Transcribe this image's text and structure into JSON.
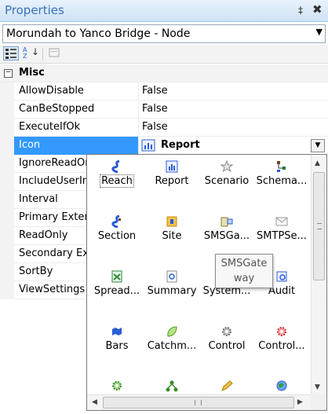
{
  "window": {
    "title": "Properties",
    "pin_glyph": "‡",
    "close_glyph": "✖"
  },
  "object_selector": {
    "value": "Morundah to Yanco Bridge - Node"
  },
  "toolbar": {
    "sort_alpha_label": "AZ"
  },
  "grid": {
    "category": {
      "label": "Misc",
      "toggle": "−"
    },
    "rows": [
      {
        "name": "AllowDisable",
        "value": "False"
      },
      {
        "name": "CanBeStopped",
        "value": "False"
      },
      {
        "name": "ExecuteIfOk",
        "value": "False"
      },
      {
        "name": "Icon",
        "value": "Report"
      },
      {
        "name": "IgnoreReadOnly",
        "value": ""
      },
      {
        "name": "IncludeUserInput",
        "value": ""
      },
      {
        "name": "Interval",
        "value": ""
      },
      {
        "name": "Primary External",
        "value": ""
      },
      {
        "name": "ReadOnly",
        "value": ""
      },
      {
        "name": "Secondary External",
        "value": ""
      },
      {
        "name": "SortBy",
        "value": ""
      },
      {
        "name": "ViewSettings",
        "value": ""
      }
    ]
  },
  "icon_picker": {
    "tiles": [
      {
        "label": "Reach",
        "icon": "reach-icon"
      },
      {
        "label": "Report",
        "icon": "report-icon"
      },
      {
        "label": "Scenario",
        "icon": "scenario-star-icon"
      },
      {
        "label": "Schema...",
        "icon": "schema-icon"
      },
      {
        "label": "Section",
        "icon": "section-icon"
      },
      {
        "label": "Site",
        "icon": "site-icon"
      },
      {
        "label": "SMSGa...",
        "icon": "smsgateway-icon"
      },
      {
        "label": "SMTPSe...",
        "icon": "smtp-envelope-icon"
      },
      {
        "label": "Spread...",
        "icon": "spreadsheet-icon"
      },
      {
        "label": "Summary",
        "icon": "summary-icon"
      },
      {
        "label": "System...",
        "icon": "system-icon"
      },
      {
        "label": "Audit",
        "icon": "audit-icon"
      },
      {
        "label": "Bars",
        "icon": "bars-icon"
      },
      {
        "label": "Catchm...",
        "icon": "catchment-leaf-icon"
      },
      {
        "label": "Control",
        "icon": "control-gear-icon"
      },
      {
        "label": "Control...",
        "icon": "control-red-gear-icon"
      }
    ],
    "tooltip": "SMSGate way",
    "colors": {
      "blue": "#2a5bd7",
      "selection": "#3399ff"
    }
  }
}
